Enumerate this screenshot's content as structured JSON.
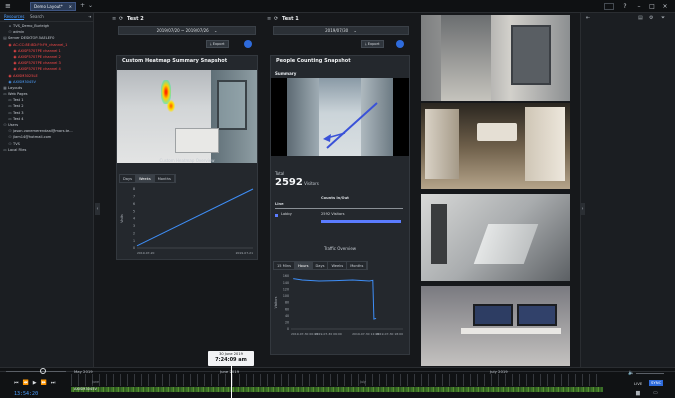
{
  "window": {
    "tab_label": "Demo Layout*",
    "tab_close": "×",
    "add_tab": "+",
    "tab_menu": "⌄",
    "help": "?",
    "min": "–",
    "max": "□",
    "close": "×"
  },
  "left_panel": {
    "tabs": [
      "Resources",
      "Search"
    ],
    "tree": [
      {
        "icon": "⌂",
        "label": "TVS_Demo_Burleigh",
        "indent": 1,
        "color": ""
      },
      {
        "icon": "⚇",
        "label": "admin",
        "indent": 1,
        "color": ""
      },
      {
        "icon": "▤",
        "label": "Server DESKTOP-5AELEF0",
        "indent": 0,
        "color": ""
      },
      {
        "icon": "◉",
        "label": "AC:CC:8E:8D:F9:F9_channel_1",
        "indent": 1,
        "color": "red"
      },
      {
        "icon": "◉",
        "label": "AXISP3707PE channel 1",
        "indent": 2,
        "color": "red"
      },
      {
        "icon": "◉",
        "label": "AXISP3707PE channel 2",
        "indent": 2,
        "color": "red"
      },
      {
        "icon": "◉",
        "label": "AXISP3707PE channel 3",
        "indent": 2,
        "color": "red"
      },
      {
        "icon": "◉",
        "label": "AXISP3707PE channel 4",
        "indent": 2,
        "color": "red"
      },
      {
        "icon": "◉",
        "label": "AXISM3025LE",
        "indent": 1,
        "color": "red"
      },
      {
        "icon": "◉",
        "label": "AXISM3045V",
        "indent": 1,
        "color": "blu"
      },
      {
        "icon": "▦",
        "label": "Layouts",
        "indent": 0,
        "color": ""
      },
      {
        "icon": "▭",
        "label": "Web Pages",
        "indent": 0,
        "color": ""
      },
      {
        "icon": "▭",
        "label": "Test 1",
        "indent": 1,
        "color": ""
      },
      {
        "icon": "▭",
        "label": "Test 2",
        "indent": 1,
        "color": ""
      },
      {
        "icon": "▭",
        "label": "Test 3",
        "indent": 1,
        "color": ""
      },
      {
        "icon": "▭",
        "label": "Test 4",
        "indent": 1,
        "color": ""
      },
      {
        "icon": "⚇",
        "label": "Users",
        "indent": 0,
        "color": ""
      },
      {
        "icon": "⚇",
        "label": "jason.vanemerendaal@mars.te...",
        "indent": 1,
        "color": ""
      },
      {
        "icon": "⚇",
        "label": "jlam14@hotmail.com",
        "indent": 1,
        "color": ""
      },
      {
        "icon": "⚇",
        "label": "TVS",
        "indent": 1,
        "color": ""
      },
      {
        "icon": "▭",
        "label": "Local Files",
        "indent": 0,
        "color": ""
      }
    ],
    "collapse": "‹"
  },
  "panel1": {
    "title": "Test 2",
    "date_range": "2019/07/20 ~ 2019/07/26",
    "export": "Export",
    "card_title": "Custom Heatmap Summary Snapshot",
    "overview_label": "Custom Heatmap Overview",
    "segments": [
      "Days",
      "Weeks",
      "Months"
    ],
    "active_segment": "Weeks",
    "chart": {
      "y_ticks": [
        "8",
        "7",
        "6",
        "5",
        "4",
        "3",
        "2",
        "1",
        "0"
      ],
      "ylabel": "Visits",
      "x_ticks": [
        "2019-07-20",
        "2019-07-21"
      ]
    }
  },
  "panel2": {
    "title": "Test 1",
    "date": "2019/07/30",
    "export": "Export",
    "card_title": "People Counting Snapshot",
    "summary_label": "Summary",
    "total_label": "Total",
    "total_value": "2592",
    "total_unit": "Visitors",
    "table_head_line": "Line",
    "table_head_counts": "Counts In/Out",
    "row_name": "Lobby",
    "row_value": "2592 Visitors",
    "traffic_label": "Traffic Overview",
    "segments": [
      "15 Mins",
      "Hours",
      "Days",
      "Weeks",
      "Months"
    ],
    "active_segment": "Hours",
    "chart": {
      "y_ticks": [
        "160",
        "140",
        "120",
        "100",
        "80",
        "60",
        "40",
        "20",
        "0"
      ],
      "ylabel": "Visitors",
      "x_ticks": [
        "2019-07-30 00:00",
        "2019-07-30 06:00",
        "2019-07-30 12:00",
        "2019-07-30 18:00"
      ]
    }
  },
  "timeline": {
    "tooltip_date": "30 June 2019",
    "tooltip_time": "7:24:09 am",
    "month_may": "May 2019",
    "month_june": "June 2019",
    "month_july": "July 2019",
    "sub_june": "June",
    "sub_july": "July",
    "time_readout": "13:54:20",
    "camera": "AXISM3045V",
    "live": "LIVE",
    "sync": "SYNC"
  },
  "chart_data": [
    {
      "type": "line",
      "title": "Custom Heatmap Overview",
      "ylabel": "Visits",
      "x": [
        "2019-07-20",
        "2019-07-21"
      ],
      "series": [
        {
          "values": [
            0.3,
            8
          ]
        }
      ],
      "ylim": [
        0,
        8
      ]
    },
    {
      "type": "line",
      "title": "Traffic Overview",
      "ylabel": "Visitors",
      "x": [
        "2019-07-30 00:00",
        "2019-07-30 06:00",
        "2019-07-30 12:00",
        "2019-07-30 18:00"
      ],
      "series": [
        {
          "values": [
            152,
            145,
            148,
            30
          ]
        }
      ],
      "ylim": [
        0,
        160
      ]
    }
  ],
  "colors": {
    "accent": "#2e6bdc",
    "line": "#3e8ef7",
    "bar": "#5b7cff"
  }
}
